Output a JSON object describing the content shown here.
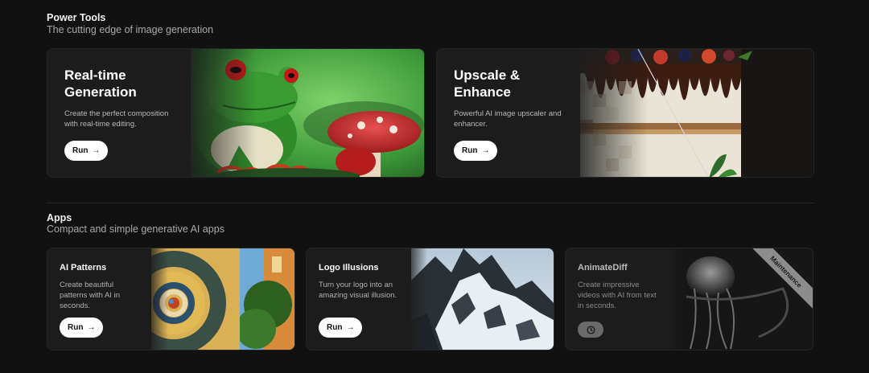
{
  "power_tools": {
    "title": "Power Tools",
    "subtitle": "The cutting edge of image generation",
    "cards": [
      {
        "title_line1": "Real-time",
        "title_line2": "Generation",
        "desc_line1": "Create the perfect composition",
        "desc_line2": "with real-time editing.",
        "button": "Run",
        "image": "frog-on-mushroom"
      },
      {
        "title_line1": "Upscale &",
        "title_line2": "Enhance",
        "desc_line1": "Powerful AI image upscaler and",
        "desc_line2": "enhancer.",
        "button": "Run",
        "image": "chocolate-drip-cake"
      }
    ]
  },
  "apps": {
    "title": "Apps",
    "subtitle": "Compact and simple generative AI apps",
    "cards": [
      {
        "title": "AI Patterns",
        "desc_line1": "Create beautiful",
        "desc_line2": "patterns with AI in",
        "desc_line3": "seconds.",
        "button": "Run",
        "image": "spiral-pattern"
      },
      {
        "title": "Logo Illusions",
        "desc_line1": "Turn your logo into an",
        "desc_line2": "amazing visual illusion.",
        "button": "Run",
        "image": "snowy-mountain"
      },
      {
        "title": "AnimateDiff",
        "desc_line1": "Create impressive",
        "desc_line2": "videos with AI from text",
        "desc_line3": "in seconds.",
        "badge": "Maintenance",
        "button_icon": "clock-icon",
        "image": "jellyfish"
      }
    ]
  },
  "icons": {
    "arrow": "→"
  },
  "colors": {
    "background": "#111111",
    "button": "#ffffff",
    "maintenance": "#8c8c8c"
  }
}
